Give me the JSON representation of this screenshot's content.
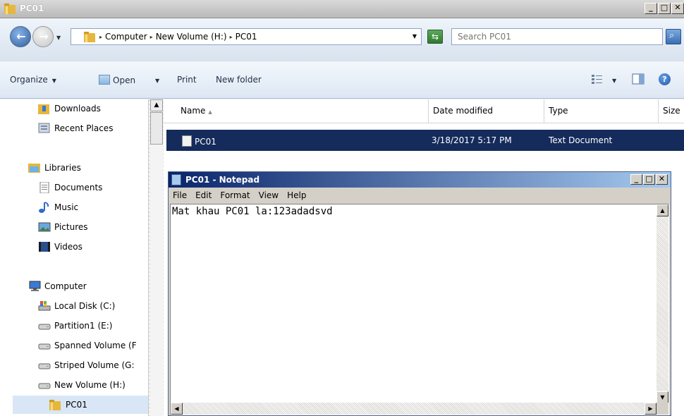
{
  "explorer": {
    "title": "PC01",
    "breadcrumbs": [
      "Computer",
      "New Volume (H:)",
      "PC01"
    ],
    "search_placeholder": "Search PC01",
    "toolbar": {
      "organize": "Organize",
      "open": "Open",
      "print": "Print",
      "new_folder": "New folder"
    },
    "nav": {
      "downloads": "Downloads",
      "recent_places": "Recent Places",
      "libraries": "Libraries",
      "documents": "Documents",
      "music": "Music",
      "pictures": "Pictures",
      "videos": "Videos",
      "computer": "Computer",
      "local_disk": "Local Disk (C:)",
      "partition1": "Partition1 (E:)",
      "spanned": "Spanned Volume (F",
      "striped": "Striped Volume (G:",
      "new_volume": "New Volume (H:)",
      "pc01": "PC01"
    },
    "columns": {
      "name": "Name",
      "date_modified": "Date modified",
      "type": "Type",
      "size": "Size"
    },
    "files": [
      {
        "name": "PC01",
        "date_modified": "3/18/2017 5:17 PM",
        "type": "Text Document"
      }
    ]
  },
  "notepad": {
    "title": "PC01 - Notepad",
    "menu": [
      "File",
      "Edit",
      "Format",
      "View",
      "Help"
    ],
    "content": "Mat khau PC01 la:123adadsvd"
  },
  "colors": {
    "selection": "#142b5b",
    "notepad_title_start": "#0a246a",
    "notepad_title_end": "#a6caf0"
  }
}
